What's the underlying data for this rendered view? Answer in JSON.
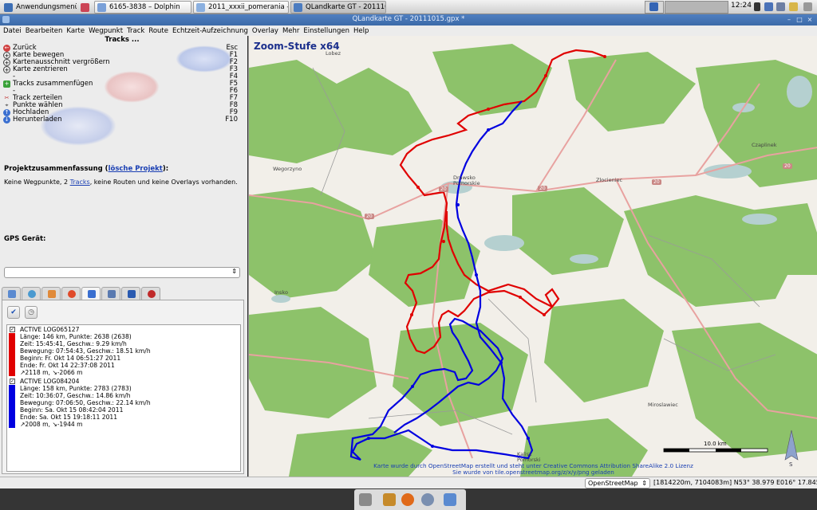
{
  "taskbar": {
    "app_menu": "Anwendungsmenü",
    "tasks": [
      {
        "label": "6165-3838 – Dolphin"
      },
      {
        "label": "2011_xxxii_pomerania – ..."
      },
      {
        "label": "QLandkarte GT - 201110..."
      }
    ],
    "clock": "12:24"
  },
  "window": {
    "title": "QLandkarte GT - 20111015.gpx *",
    "min": "–",
    "max": "□",
    "close": "×"
  },
  "menu": [
    "Datei",
    "Bearbeiten",
    "Karte",
    "Wegpunkt",
    "Track",
    "Route",
    "Echtzeit-Aufzeichnung",
    "Overlay",
    "Mehr",
    "Einstellungen",
    "Help"
  ],
  "left": {
    "tracks_header": "Tracks ...",
    "commands": [
      {
        "icon": "back-arrow-icon",
        "label": "Zurück",
        "key": "Esc"
      },
      {
        "icon": "move-map-icon",
        "label": "Karte bewegen",
        "key": "F1"
      },
      {
        "icon": "zoom-region-icon",
        "label": "Kartenausschnitt vergrößern",
        "key": "F2"
      },
      {
        "icon": "center-map-icon",
        "label": "Karte zentrieren",
        "key": "F3"
      },
      {
        "icon": "",
        "label": "-",
        "key": "F4"
      },
      {
        "icon": "combine-tracks-icon",
        "label": "Tracks zusammenfügen",
        "key": "F5"
      },
      {
        "icon": "",
        "label": "-",
        "key": "F6"
      },
      {
        "icon": "split-track-icon",
        "label": "Track zerteilen",
        "key": "F7"
      },
      {
        "icon": "select-points-icon",
        "label": "Punkte wählen",
        "key": "F8"
      },
      {
        "icon": "upload-icon",
        "label": "Hochladen",
        "key": "F9"
      },
      {
        "icon": "download-icon",
        "label": "Herunterladen",
        "key": "F10"
      }
    ],
    "project": {
      "title": "Projektzusammenfassung (",
      "title_link": "lösche Projekt",
      "title_end": "):",
      "text_before": "Keine Wegpunkte, 2 ",
      "text_link": "Tracks",
      "text_after": ", keine Routen und keine Overlays vorhanden."
    },
    "gps_label": "GPS Gerät:",
    "gps_value": "",
    "tracks": [
      {
        "color": "#e00000",
        "lines": [
          "ACTIVE LOG065127",
          "Länge: 146 km, Punkte: 2638 (2638)",
          "Zeit:   15:45:41, Geschw.: 9.29 km/h",
          "Bewegung: 07:54:43, Geschw.: 18.51 km/h",
          "Beginn: Fr. Okt 14 06:51:27 2011",
          "Ende: Fr. Okt 14 22:37:08 2011",
          "↗2118 m, ↘-2066 m"
        ]
      },
      {
        "color": "#0000e0",
        "lines": [
          "ACTIVE LOG084204",
          "Länge: 158 km, Punkte: 2783 (2783)",
          "Zeit:   10:36:07, Geschw.: 14.86 km/h",
          "Bewegung: 07:06:50, Geschw.: 22.14 km/h",
          "Beginn: Sa. Okt 15 08:42:04 2011",
          "Ende: Sa. Okt 15 19:18:11 2011",
          "↗2008 m, ↘-1944 m"
        ]
      }
    ]
  },
  "map": {
    "zoom_label": "Zoom-Stufe x64",
    "places": [
      "Lobez",
      "Wegorzyno",
      "Drawsko Pomorskie",
      "Zlocieniec",
      "Czaplinek",
      "Insko",
      "Miroslawiec",
      "Kalisz Pomorski"
    ],
    "road_labels": [
      "20",
      "20",
      "20",
      "20",
      "20"
    ],
    "scale_label": "10.0 km",
    "compass": "S",
    "attribution_1": "Karte wurde durch OpenStreetMap erstellt und steht unter Creative Commons Attribution ShareAlike 2.0 Lizenz",
    "attribution_2": "Sie wurde von tile.openstreetmap.org/z/x/y/png geladen"
  },
  "status": {
    "map_source": "OpenStreetMap",
    "coords": "[1814220m, 7104083m] N53° 38.979 E016° 17.845"
  },
  "colors": {
    "track1": "#e00000",
    "track2": "#0000e0",
    "forest": "#8dc26a",
    "water": "#b5d0d0",
    "road": "#e8a2a0"
  }
}
